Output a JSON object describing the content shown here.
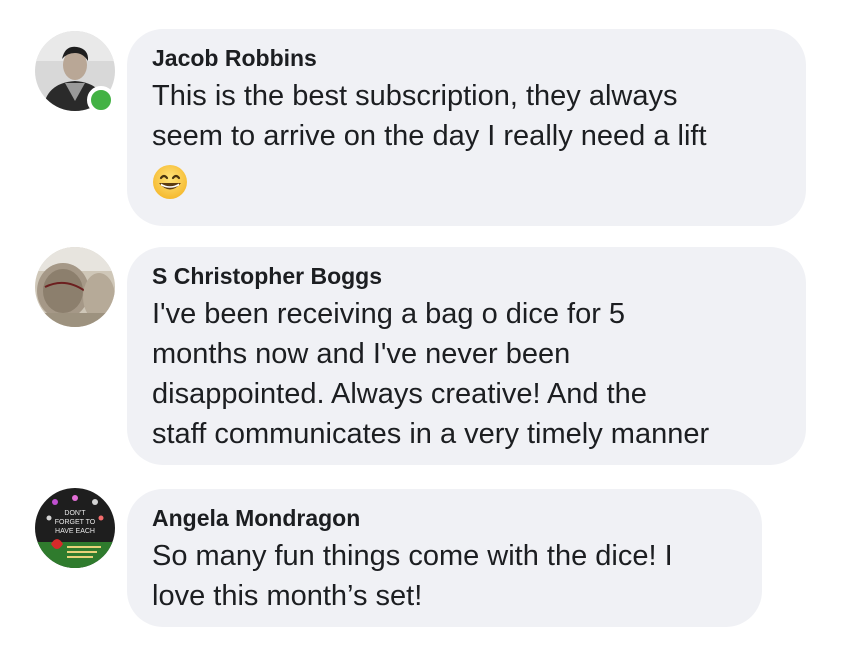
{
  "comments": [
    {
      "author": "Jacob Robbins",
      "text": "This is the best subscription, they always\nseem to arrive on the day I really need a lift",
      "emoji": "grinning-face-with-smiling-eyes",
      "online": true
    },
    {
      "author": "S Christopher Boggs",
      "text": "I've been receiving a bag o dice for 5\nmonths now and I've never been\ndisappointed.  Always creative! And the\nstaff communicates in a very timely manner",
      "online": false
    },
    {
      "author": "Angela Mondragon",
      "text": "So many fun things come with the dice! I\nlove this month’s set!",
      "online": false,
      "avatar_text": [
        "DON'T",
        "FORGET TO",
        "HAVE EACH"
      ]
    }
  ],
  "colors": {
    "bubble": "#f0f1f5",
    "text": "#1c1e21",
    "online": "#43b244"
  }
}
